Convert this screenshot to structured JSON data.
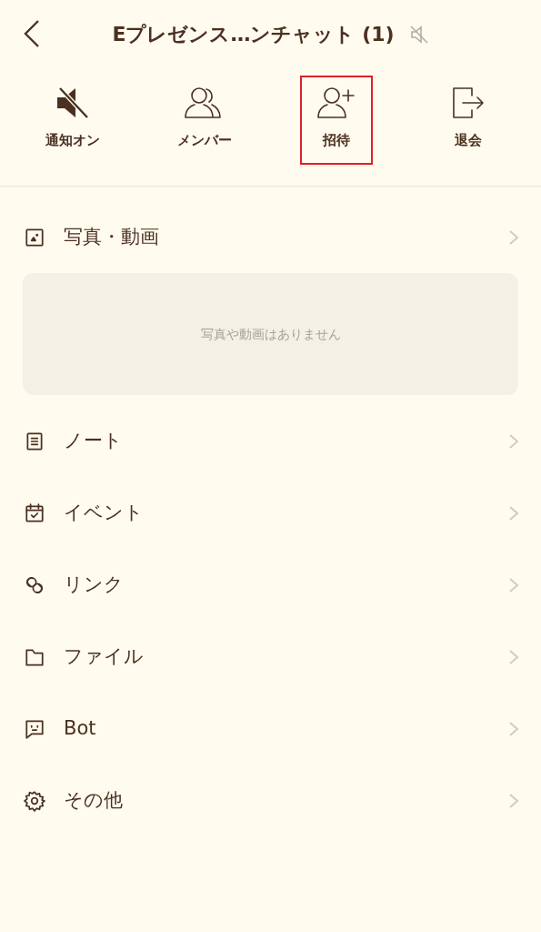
{
  "header": {
    "title": "Eプレゼンス…ンチャット (1)",
    "muted": true
  },
  "actions": [
    {
      "kind": "mute",
      "label": "通知オン",
      "highlighted": false
    },
    {
      "kind": "members",
      "label": "メンバー",
      "highlighted": false
    },
    {
      "kind": "invite",
      "label": "招待",
      "highlighted": true
    },
    {
      "kind": "leave",
      "label": "退会",
      "highlighted": false
    }
  ],
  "menu": [
    {
      "kind": "photo",
      "label": "写真・動画",
      "empty_text": "写真や動画はありません"
    },
    {
      "kind": "note",
      "label": "ノート"
    },
    {
      "kind": "event",
      "label": "イベント"
    },
    {
      "kind": "link",
      "label": "リンク"
    },
    {
      "kind": "file",
      "label": "ファイル"
    },
    {
      "kind": "bot",
      "label": "Bot"
    },
    {
      "kind": "settings",
      "label": "その他"
    }
  ]
}
